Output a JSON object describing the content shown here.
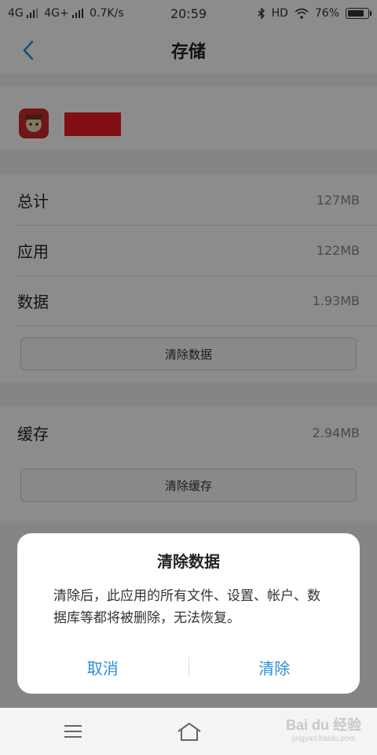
{
  "status_bar": {
    "sim1": "4G",
    "sim2": "4G+",
    "speed": "0.7K/s",
    "time": "20:59",
    "bluetooth_icon": "bluetooth-icon",
    "hd": "HD",
    "battery_percent": "76%"
  },
  "header": {
    "title": "存储",
    "back_icon": "chevron-left-icon"
  },
  "app": {
    "icon": "app-icon"
  },
  "storage": {
    "total_label": "总计",
    "total_value": "127MB",
    "app_label": "应用",
    "app_value": "122MB",
    "data_label": "数据",
    "data_value": "1.93MB",
    "clear_data_button": "清除数据",
    "cache_label": "缓存",
    "cache_value": "2.94MB",
    "clear_cache_button": "清除缓存"
  },
  "dialog": {
    "title": "清除数据",
    "message": "清除后，此应用的所有文件、设置、帐户、数据库等都将被删除，无法恢复。",
    "cancel": "取消",
    "confirm": "清除"
  },
  "watermark": {
    "main": "Bai du 经验",
    "sub": "jingyan.baidu.com"
  },
  "colors": {
    "accent": "#2b8fd6",
    "redaction": "#ec1c24"
  }
}
